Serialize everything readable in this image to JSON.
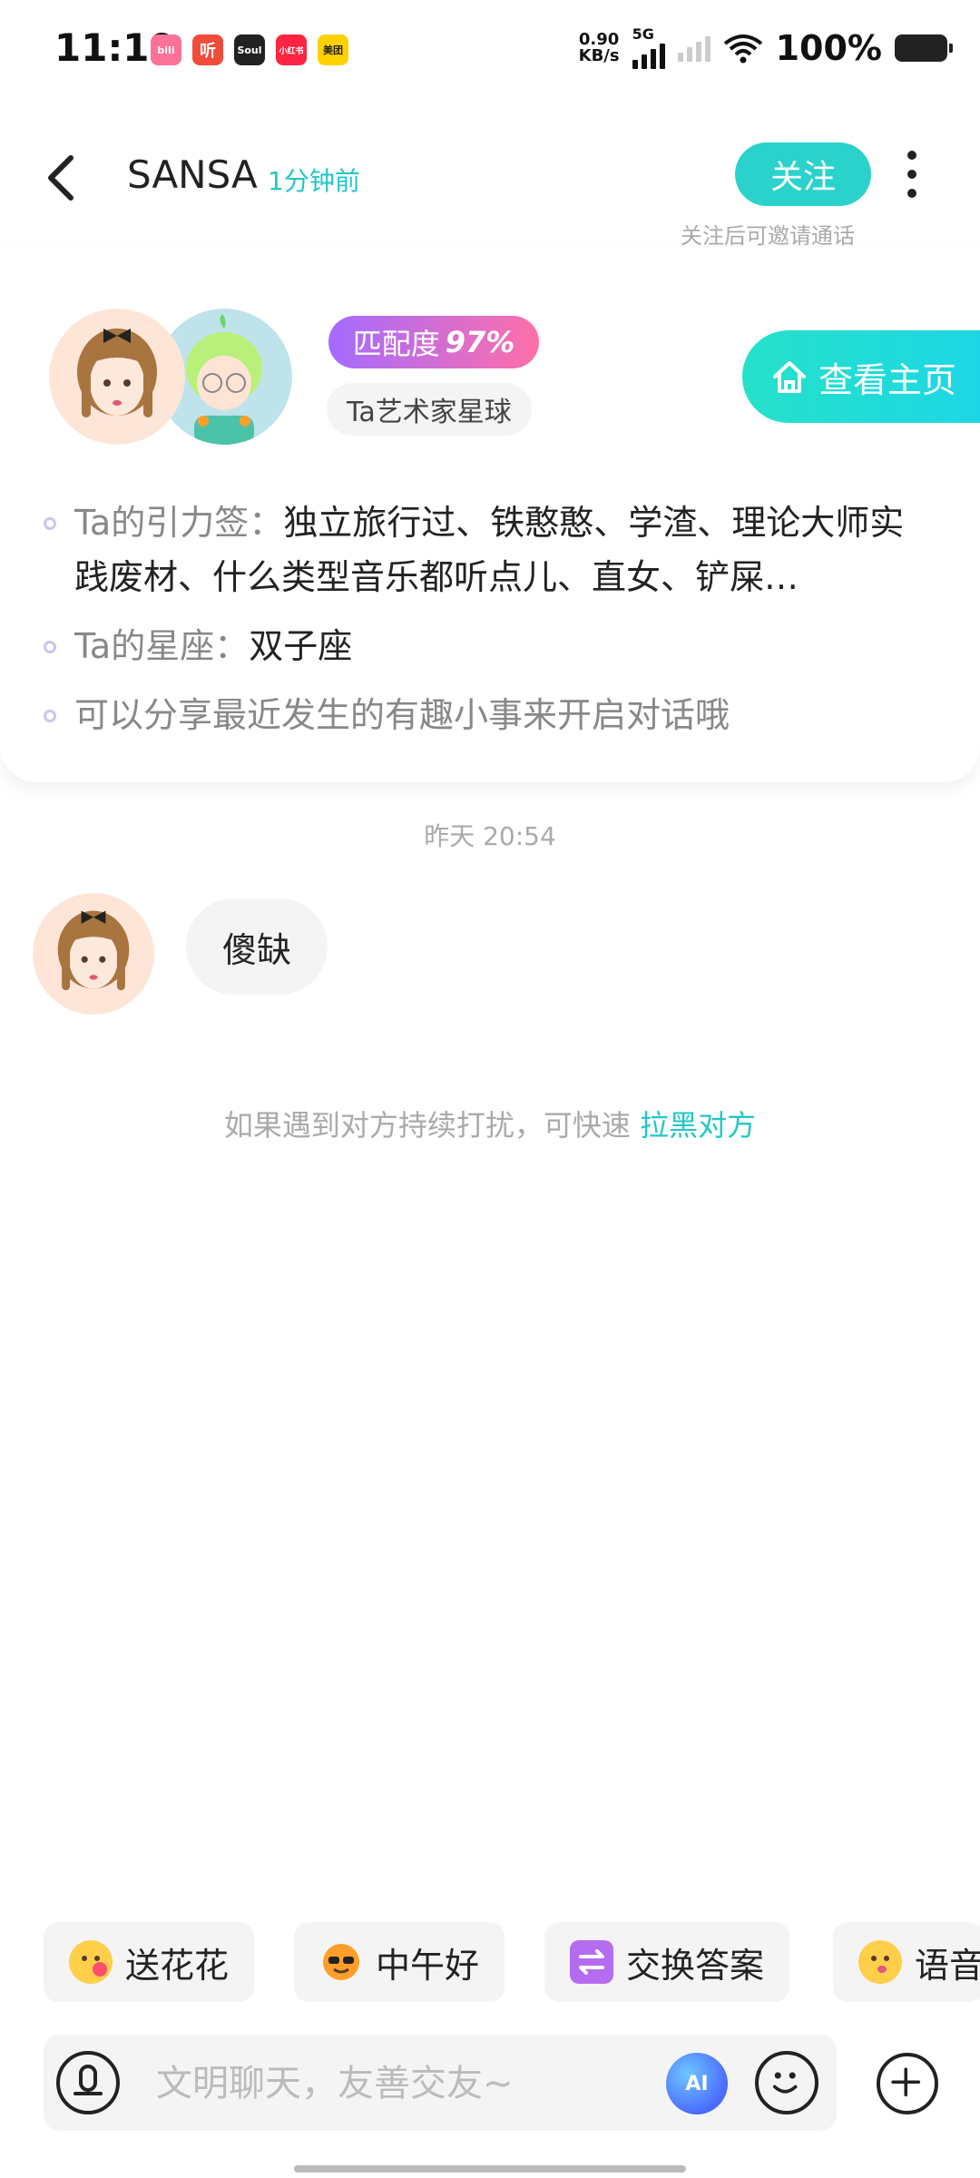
{
  "status_bar": {
    "time": "11:19",
    "apps": [
      {
        "name": "bilibili",
        "label": "bili",
        "color": "#fb7299"
      },
      {
        "name": "ting",
        "label": "听",
        "color": "#f24b3b"
      },
      {
        "name": "soul",
        "label": "Soul",
        "color": "#222222"
      },
      {
        "name": "xiaohongshu",
        "label": "小红书",
        "color": "#ff2442"
      },
      {
        "name": "meituan",
        "label": "美团",
        "color": "#ffd100"
      }
    ],
    "net_speed_value": "0.90",
    "net_speed_unit": "KB/s",
    "network": "5G",
    "battery": "100%"
  },
  "header": {
    "name": "SANSA",
    "last_active": "1分钟前",
    "follow_label": "关注",
    "follow_hint": "关注后可邀请通话"
  },
  "profile": {
    "match_label": "匹配度",
    "match_value": "97%",
    "planet_tag": "Ta艺术家星球",
    "home_button": "查看主页",
    "attraction_key": "Ta的引力签：",
    "attraction_value": "独立旅行过、铁憨憨、学渣、理论大师实践废材、什么类型音乐都听点儿、直女、铲屎…",
    "zodiac_key": "Ta的星座：",
    "zodiac_value": "双子座",
    "tip": "可以分享最近发生的有趣小事来开启对话哦"
  },
  "chat": {
    "timestamp": "昨天 20:54",
    "message": "傻缺",
    "notice_text": "如果遇到对方持续打扰，可快速",
    "notice_link": "拉黑对方"
  },
  "quick_chips": [
    {
      "label": "送花花",
      "icon": "flower-face-icon"
    },
    {
      "label": "中午好",
      "icon": "sun-sunglasses-icon"
    },
    {
      "label": "交换答案",
      "icon": "exchange-icon"
    },
    {
      "label": "语音",
      "icon": "voice-face-icon"
    }
  ],
  "input": {
    "placeholder": "文明聊天，友善交友~",
    "ai_label": "AI"
  },
  "colors": {
    "accent": "#2ad2cb",
    "link": "#22c7c7",
    "match_gradient_start": "#a36bff",
    "match_gradient_end": "#ff6fa8"
  }
}
